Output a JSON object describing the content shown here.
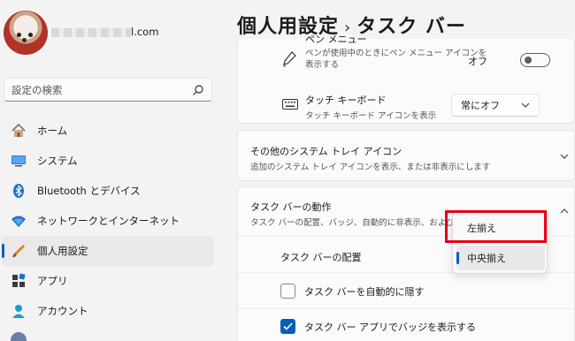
{
  "profile": {
    "email_suffix": "l.com"
  },
  "search": {
    "placeholder": "設定の検索"
  },
  "nav": {
    "items": [
      {
        "label": "ホーム",
        "icon": "home-icon"
      },
      {
        "label": "システム",
        "icon": "system-icon"
      },
      {
        "label": "Bluetooth とデバイス",
        "icon": "bluetooth-icon"
      },
      {
        "label": "ネットワークとインターネット",
        "icon": "network-icon"
      },
      {
        "label": "個人用設定",
        "icon": "personalization-icon",
        "active": true
      },
      {
        "label": "アプリ",
        "icon": "apps-icon"
      },
      {
        "label": "アカウント",
        "icon": "account-icon"
      }
    ]
  },
  "header": {
    "parent": "個人用設定",
    "separator": "›",
    "current": "タスク バー"
  },
  "pen_menu": {
    "title": "ペン メニュー",
    "desc": "ペンが使用中のときにペン メニュー アイコンを表示する",
    "toggle_label": "オフ",
    "toggle_state": "off"
  },
  "touch_keyboard": {
    "title": "タッチ キーボード",
    "desc": "タッチ キーボード アイコンを表示",
    "value": "常にオフ"
  },
  "other_tray": {
    "title": "その他のシステム トレイ アイコン",
    "desc": "追加のシステム トレイ アイコンを表示、または非表示にします"
  },
  "taskbar_behavior": {
    "title": "タスク バーの動作",
    "desc": "タスク バーの配置、バッジ、自動的に非表示、および複数",
    "alignment_label": "タスク バーの配置",
    "auto_hide_label": "タスク バーを自動的に隠す",
    "auto_hide_checked": false,
    "badges_label": "タスク バー アプリでバッジを表示する",
    "badges_checked": true
  },
  "alignment_popup": {
    "options": [
      "左揃え",
      "中央揃え"
    ],
    "selected": "中央揃え",
    "highlighted": "左揃え"
  },
  "colors": {
    "accent": "#005fb8",
    "highlight": "#e60012"
  }
}
